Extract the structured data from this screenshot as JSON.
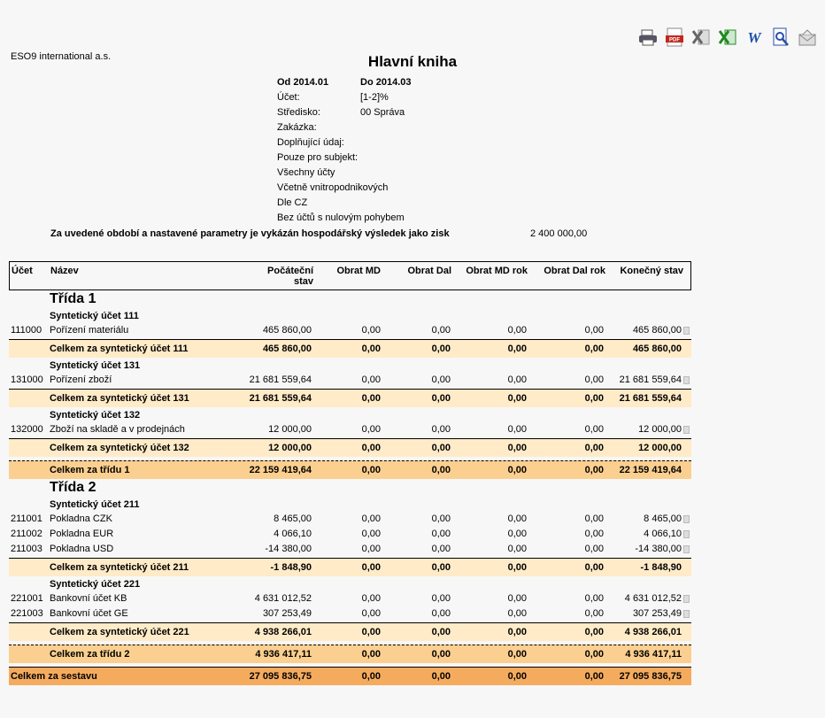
{
  "toolbar": {
    "icons": [
      "print-icon",
      "pdf-icon",
      "excel-x-icon",
      "excel-icon",
      "word-icon",
      "preview-icon",
      "email-icon"
    ]
  },
  "company": "ESO9 international a.s.",
  "title": "Hlavní kniha",
  "params": {
    "od": "Od 2014.01",
    "do": "Do 2014.03",
    "ucet_label": "Účet:",
    "ucet_value": "[1-2]%",
    "stredisko_label": "Středisko:",
    "stredisko_value": "00 Správa",
    "zakazka": "Zakázka:",
    "doplnujici": "Doplňující údaj:",
    "subjekt": "Pouze pro subjekt:",
    "vsechny": "Všechny účty",
    "vcetne": "Včetně vnitropodnikových",
    "dle": "Dle CZ",
    "bez": "Bez účtů s nulovým pohybem"
  },
  "result": {
    "text": "Za uvedené období a nastavené parametry je vykázán hospodářský výsledek jako zisk",
    "value": "2 400 000,00"
  },
  "header": {
    "ucet": "Účet",
    "nazev": "Název",
    "pocatecni1": "Počáteční",
    "pocatecni2": "stav",
    "obrat_md": "Obrat MD",
    "obrat_dal": "Obrat Dal",
    "obrat_md_rok": "Obrat MD rok",
    "obrat_dal_rok": "Obrat Dal rok",
    "konecny": "Konečný stav"
  },
  "trida1": {
    "label": "Třída 1",
    "s111": {
      "label": "Syntetický účet 111",
      "rows": [
        {
          "ucet": "111000",
          "nazev": "Pořízení materiálu",
          "v": [
            "465 860,00",
            "0,00",
            "0,00",
            "0,00",
            "0,00",
            "465 860,00"
          ]
        }
      ],
      "sum": {
        "label": "Celkem za syntetický účet 111",
        "v": [
          "465 860,00",
          "0,00",
          "0,00",
          "0,00",
          "0,00",
          "465 860,00"
        ]
      }
    },
    "s131": {
      "label": "Syntetický účet 131",
      "rows": [
        {
          "ucet": "131000",
          "nazev": "Pořízení zboží",
          "v": [
            "21 681 559,64",
            "0,00",
            "0,00",
            "0,00",
            "0,00",
            "21 681 559,64"
          ]
        }
      ],
      "sum": {
        "label": "Celkem za syntetický účet 131",
        "v": [
          "21 681 559,64",
          "0,00",
          "0,00",
          "0,00",
          "0,00",
          "21 681 559,64"
        ]
      }
    },
    "s132": {
      "label": "Syntetický účet 132",
      "rows": [
        {
          "ucet": "132000",
          "nazev": "Zboží na skladě a v prodejnách",
          "v": [
            "12 000,00",
            "0,00",
            "0,00",
            "0,00",
            "0,00",
            "12 000,00"
          ]
        }
      ],
      "sum": {
        "label": "Celkem za syntetický účet 132",
        "v": [
          "12 000,00",
          "0,00",
          "0,00",
          "0,00",
          "0,00",
          "12 000,00"
        ]
      }
    },
    "sum": {
      "label": "Celkem za třídu 1",
      "v": [
        "22 159 419,64",
        "0,00",
        "0,00",
        "0,00",
        "0,00",
        "22 159 419,64"
      ]
    }
  },
  "trida2": {
    "label": "Třída 2",
    "s211": {
      "label": "Syntetický účet 211",
      "rows": [
        {
          "ucet": "211001",
          "nazev": "Pokladna CZK",
          "v": [
            "8 465,00",
            "0,00",
            "0,00",
            "0,00",
            "0,00",
            "8 465,00"
          ]
        },
        {
          "ucet": "211002",
          "nazev": "Pokladna EUR",
          "v": [
            "4 066,10",
            "0,00",
            "0,00",
            "0,00",
            "0,00",
            "4 066,10"
          ]
        },
        {
          "ucet": "211003",
          "nazev": "Pokladna USD",
          "v": [
            "-14 380,00",
            "0,00",
            "0,00",
            "0,00",
            "0,00",
            "-14 380,00"
          ]
        }
      ],
      "sum": {
        "label": "Celkem za syntetický účet 211",
        "v": [
          "-1 848,90",
          "0,00",
          "0,00",
          "0,00",
          "0,00",
          "-1 848,90"
        ]
      }
    },
    "s221": {
      "label": "Syntetický účet 221",
      "rows": [
        {
          "ucet": "221001",
          "nazev": "Bankovní účet KB",
          "v": [
            "4 631 012,52",
            "0,00",
            "0,00",
            "0,00",
            "0,00",
            "4 631 012,52"
          ]
        },
        {
          "ucet": "221003",
          "nazev": "Bankovní účet GE",
          "v": [
            "307 253,49",
            "0,00",
            "0,00",
            "0,00",
            "0,00",
            "307 253,49"
          ]
        }
      ],
      "sum": {
        "label": "Celkem za syntetický účet 221",
        "v": [
          "4 938 266,01",
          "0,00",
          "0,00",
          "0,00",
          "0,00",
          "4 938 266,01"
        ]
      }
    },
    "sum": {
      "label": "Celkem za třídu 2",
      "v": [
        "4 936 417,11",
        "0,00",
        "0,00",
        "0,00",
        "0,00",
        "4 936 417,11"
      ]
    }
  },
  "total": {
    "label": "Celkem za sestavu",
    "v": [
      "27 095 836,75",
      "0,00",
      "0,00",
      "0,00",
      "0,00",
      "27 095 836,75"
    ]
  }
}
